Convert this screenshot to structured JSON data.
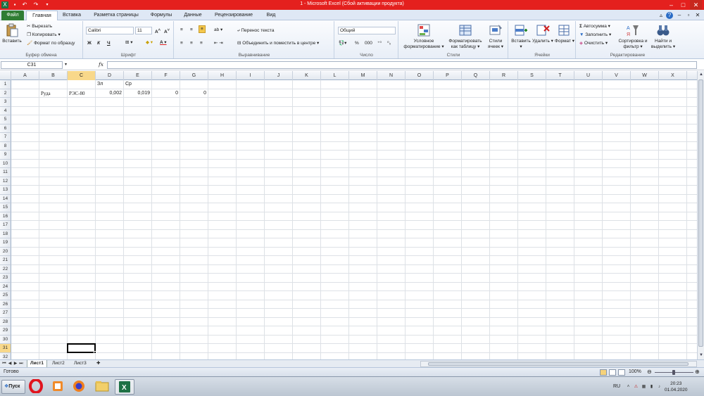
{
  "window": {
    "title": "1 -  Microsoft Excel (Сбой активации продукта)"
  },
  "tabs": [
    "Файл",
    "Главная",
    "Вставка",
    "Разметка страницы",
    "Формулы",
    "Данные",
    "Рецензирование",
    "Вид"
  ],
  "ribbon": {
    "clipboard": {
      "paste": "Вставить",
      "cut": "Вырезать",
      "copy": "Копировать",
      "format_painter": "Формат по образцу",
      "label": "Буфер обмена"
    },
    "font": {
      "name": "Calibri",
      "size": "11",
      "bold": "Ж",
      "italic": "К",
      "underline": "Ч",
      "label": "Шрифт"
    },
    "alignment": {
      "wrap": "Перенос текста",
      "merge": "Объединить и поместить в центре",
      "label": "Выравнивание"
    },
    "number": {
      "format": "Общий",
      "label": "Число"
    },
    "styles": {
      "conditional": "Условное форматирование",
      "as_table": "Форматировать как таблицу",
      "cell_styles": "Стили ячеек",
      "label": "Стили"
    },
    "cells": {
      "insert": "Вставить",
      "delete": "Удалить",
      "format": "Формат",
      "label": "Ячейки"
    },
    "editing": {
      "autosum": "Автосумма",
      "fill": "Заполнить",
      "clear": "Очистить",
      "sort": "Сортировка и фильтр",
      "find": "Найти и выделить",
      "label": "Редактирование"
    }
  },
  "formula_bar": {
    "name_box": "C31",
    "fx": "fx",
    "formula": ""
  },
  "columns": [
    "A",
    "B",
    "C",
    "D",
    "E",
    "F",
    "G",
    "H",
    "I",
    "J",
    "K",
    "L",
    "M",
    "N",
    "O",
    "P",
    "Q",
    "R",
    "S",
    "T",
    "U",
    "V",
    "W",
    "X"
  ],
  "rows": [
    "1",
    "2",
    "3",
    "4",
    "5",
    "6",
    "7",
    "8",
    "9",
    "10",
    "11",
    "12",
    "13",
    "14",
    "15",
    "16",
    "17",
    "18",
    "19",
    "20",
    "21",
    "22",
    "23",
    "24",
    "25",
    "26",
    "27",
    "28",
    "29",
    "30",
    "31",
    "32"
  ],
  "cells": {
    "D1": "Зл",
    "E1": "Ср",
    "B2": "Руда",
    "C2": "РЭС-80",
    "D2": "0,002",
    "E2": "0,019",
    "F2": "0",
    "G2": "0"
  },
  "selected_cell": "C31",
  "sheets": [
    "Лист1",
    "Лист2",
    "Лист3"
  ],
  "status": {
    "ready": "Готово",
    "zoom": "100%"
  },
  "taskbar": {
    "start": "Пуск",
    "lang": "RU",
    "time": "20:23",
    "date": "01.04.2020"
  }
}
